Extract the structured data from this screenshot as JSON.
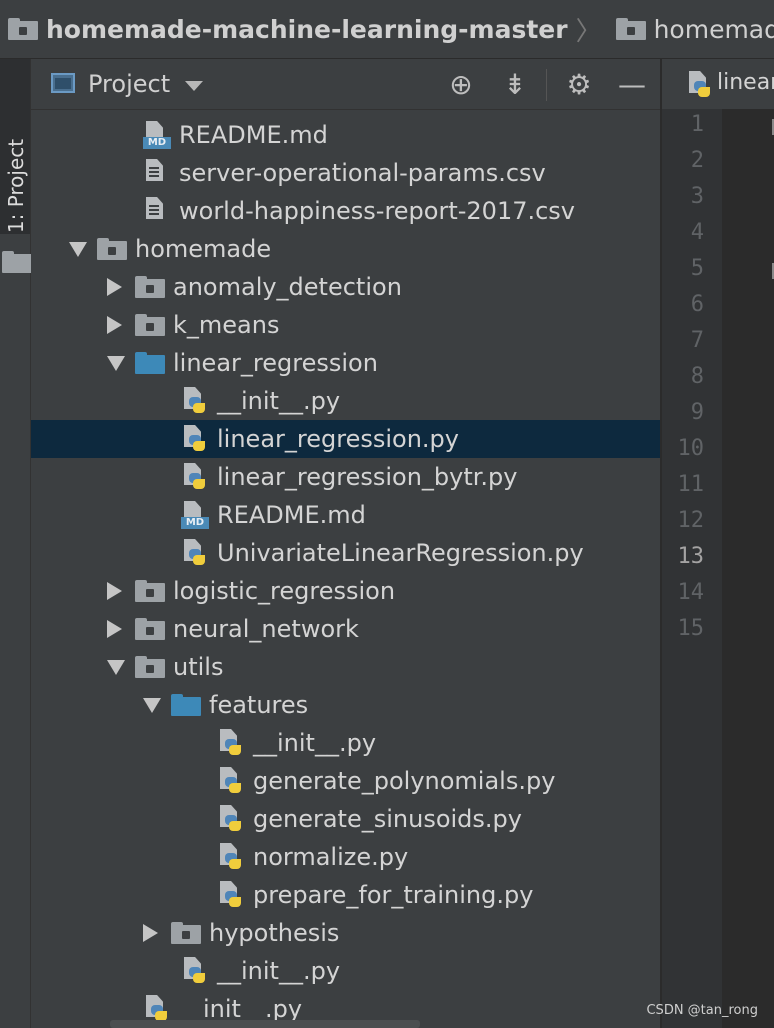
{
  "breadcrumb": {
    "items": [
      "homemade-machine-learning-master",
      "homemade",
      ""
    ]
  },
  "side_tab": {
    "label": "1: Project"
  },
  "project_panel": {
    "title": "Project",
    "tool_icons": [
      "locate-icon",
      "collapse-all-icon",
      "gear-icon",
      "minimize-icon"
    ]
  },
  "tree": [
    {
      "name": "README.md",
      "type": "md"
    },
    {
      "name": "server-operational-params.csv",
      "type": "text"
    },
    {
      "name": "world-happiness-report-2017.csv",
      "type": "text"
    },
    {
      "name": "homemade",
      "type": "folder",
      "expanded": true
    },
    {
      "name": "anomaly_detection",
      "type": "folder",
      "expanded": false
    },
    {
      "name": "k_means",
      "type": "folder",
      "expanded": false
    },
    {
      "name": "linear_regression",
      "type": "folder-open",
      "expanded": true
    },
    {
      "name": "__init__.py",
      "type": "py"
    },
    {
      "name": "linear_regression.py",
      "type": "py",
      "selected": true
    },
    {
      "name": "linear_regression_bytr.py",
      "type": "py"
    },
    {
      "name": "README.md",
      "type": "md"
    },
    {
      "name": "UnivariateLinearRegression.py",
      "type": "py"
    },
    {
      "name": "logistic_regression",
      "type": "folder",
      "expanded": false
    },
    {
      "name": "neural_network",
      "type": "folder",
      "expanded": false
    },
    {
      "name": "utils",
      "type": "folder",
      "expanded": true
    },
    {
      "name": "features",
      "type": "folder-open",
      "expanded": true
    },
    {
      "name": "__init__.py",
      "type": "py"
    },
    {
      "name": "generate_polynomials.py",
      "type": "py"
    },
    {
      "name": "generate_sinusoids.py",
      "type": "py"
    },
    {
      "name": "normalize.py",
      "type": "py"
    },
    {
      "name": "prepare_for_training.py",
      "type": "py"
    },
    {
      "name": "hypothesis",
      "type": "folder",
      "expanded": false
    },
    {
      "name": "__init__.py",
      "type": "py"
    },
    {
      "name": "__init__.py",
      "type": "py"
    }
  ],
  "editor": {
    "tab_label": "linear",
    "line_numbers": [
      "1",
      "2",
      "3",
      "4",
      "5",
      "6",
      "7",
      "8",
      "9",
      "10",
      "11",
      "12",
      "13",
      "14",
      "15"
    ],
    "current_line": "13"
  },
  "watermark": "CSDN @tan_rong",
  "colors": {
    "selection": "#0d293e",
    "folder_open": "#3d89b8",
    "panel_bg": "#3c3f41"
  }
}
